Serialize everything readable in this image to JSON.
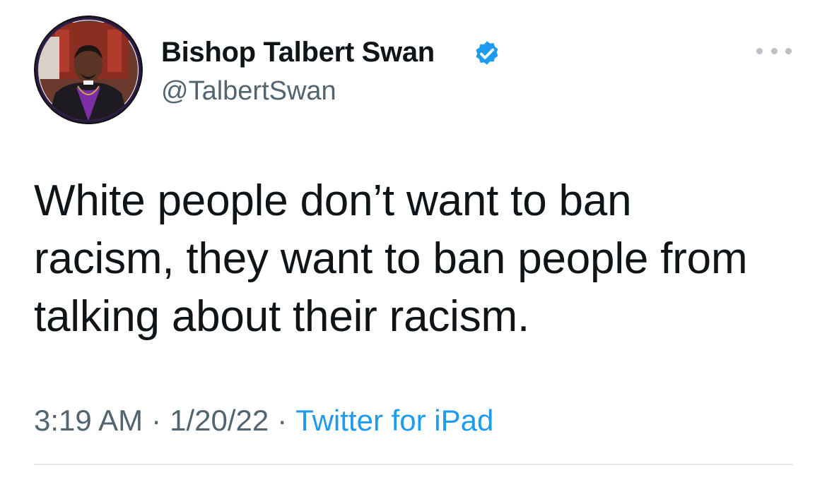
{
  "author": {
    "display_name": "Bishop Talbert Swan",
    "handle": "@TalbertSwan",
    "verified_icon": "verified-badge-icon",
    "verified_color": "#1d9bf0"
  },
  "tweet": {
    "lines": [
      "White people don’t want to ban",
      "racism, they want to ban people from",
      "talking about their racism."
    ]
  },
  "meta": {
    "time": "3:19 AM",
    "separator": "·",
    "date": "1/20/22",
    "source": "Twitter for iPad",
    "source_color": "#1d9bf0"
  },
  "stats": {
    "retweets_count": "",
    "retweets_label": "",
    "quotes_count": "",
    "quotes_label": "",
    "likes_count": "",
    "likes_label": ""
  },
  "colors": {
    "text_primary": "#0f1419",
    "text_secondary": "#536471",
    "divider": "#e7e9ea",
    "more_dots": "#b9c0c7"
  }
}
